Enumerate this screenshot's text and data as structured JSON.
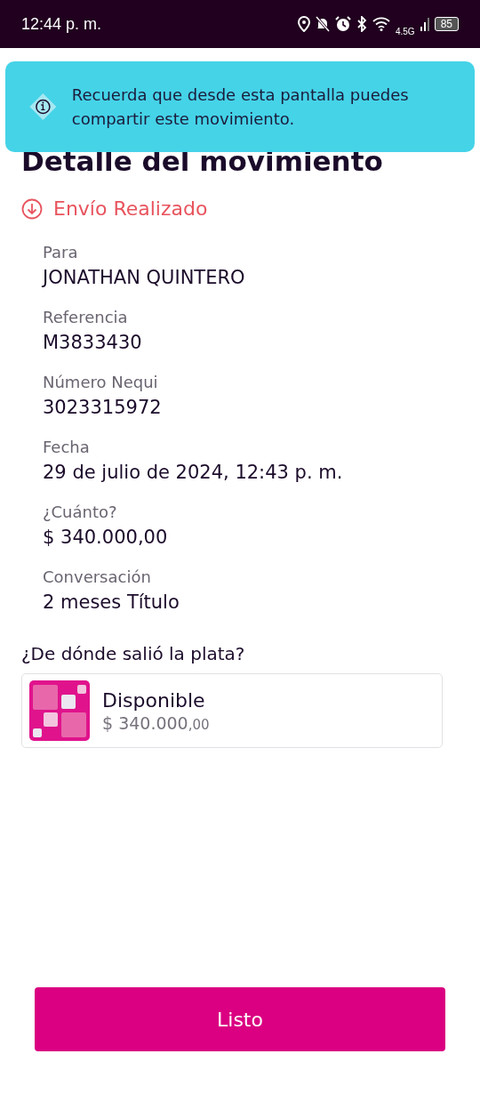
{
  "status_bar": {
    "time": "12:44 p. m.",
    "network": "4.5G",
    "battery": "85"
  },
  "toast": {
    "message": "Recuerda que desde esta pantalla puedes compartir este movimiento."
  },
  "title": "Detalle del movimiento",
  "movement_status": {
    "label": "Envío Realizado"
  },
  "fields": [
    {
      "label": "Para",
      "value": "JONATHAN QUINTERO"
    },
    {
      "label": "Referencia",
      "value": "M3833430"
    },
    {
      "label": "Número Nequi",
      "value": "3023315972"
    },
    {
      "label": "Fecha",
      "value": "29 de julio de 2024, 12:43 p. m."
    },
    {
      "label": "¿Cuánto?",
      "value": "$ 340.000,00"
    },
    {
      "label": "Conversación",
      "value": "2 meses Título"
    }
  ],
  "source": {
    "heading": "¿De dónde salió la plata?",
    "name": "Disponible",
    "amount": "$ 340.000",
    "cents": ",00"
  },
  "button": "Listo"
}
